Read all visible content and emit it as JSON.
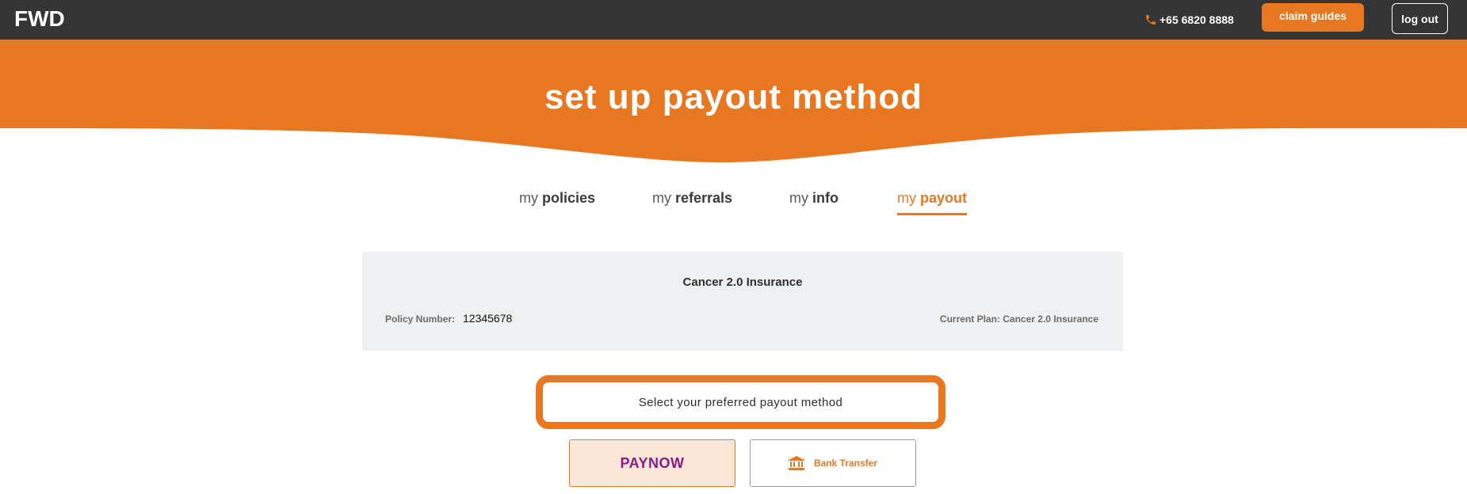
{
  "header": {
    "logo_text": "FWD",
    "phone": "+65 6820 8888",
    "claim_guides_label": "claim guides",
    "logout_label": "log out",
    "brand_color": "#e87722"
  },
  "hero": {
    "title": "set up payout method"
  },
  "tabs": [
    {
      "prefix": "my",
      "name": "policies",
      "active": false
    },
    {
      "prefix": "my",
      "name": "referrals",
      "active": false
    },
    {
      "prefix": "my",
      "name": "info",
      "active": false
    },
    {
      "prefix": "my",
      "name": "payout",
      "active": true
    }
  ],
  "policy": {
    "title": "Cancer 2.0 Insurance",
    "number_label": "Policy Number:",
    "number_value": "12345678",
    "current_plan": "Current Plan: Cancer 2.0 Insurance"
  },
  "payout": {
    "prompt": "Select your preferred payout method",
    "options": [
      {
        "name": "PAYNOW",
        "icon": "paynow-logo",
        "selected": true
      },
      {
        "name": "Bank Transfer",
        "icon": "bank-icon",
        "selected": false
      }
    ]
  }
}
